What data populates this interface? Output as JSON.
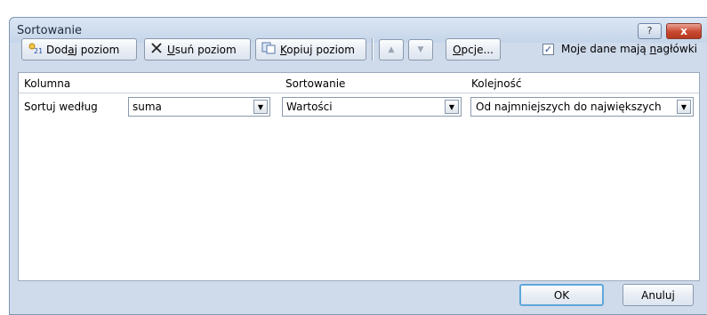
{
  "window": {
    "title": "Sortowanie",
    "help_label": "?",
    "close_label": "x"
  },
  "toolbar": {
    "add_level": {
      "pre": "Dod",
      "ul": "a",
      "post": "j poziom"
    },
    "delete_level": {
      "pre": "",
      "ul": "U",
      "post": "suń poziom"
    },
    "copy_level": {
      "pre": "",
      "ul": "K",
      "post": "opiuj poziom"
    },
    "move_up": "▲",
    "move_down": "▼",
    "options": {
      "pre": "",
      "ul": "O",
      "post": "pcje..."
    },
    "headers_checkbox": {
      "checked": true,
      "pre": "Moje dane mają ",
      "ul": "n",
      "post": "agłówki"
    }
  },
  "grid": {
    "headers": {
      "column": "Kolumna",
      "sort_on": "Sortowanie",
      "order": "Kolejność"
    },
    "rows": [
      {
        "label": "Sortuj według",
        "column": "suma",
        "sort_on": "Wartości",
        "order": "Od najmniejszych do największych"
      }
    ]
  },
  "footer": {
    "ok": "OK",
    "cancel": "Anuluj"
  },
  "colors": {
    "dialog_bg": "#cfdbeb",
    "close_red": "#c9472f",
    "ok_focus": "#5fa7d9"
  }
}
